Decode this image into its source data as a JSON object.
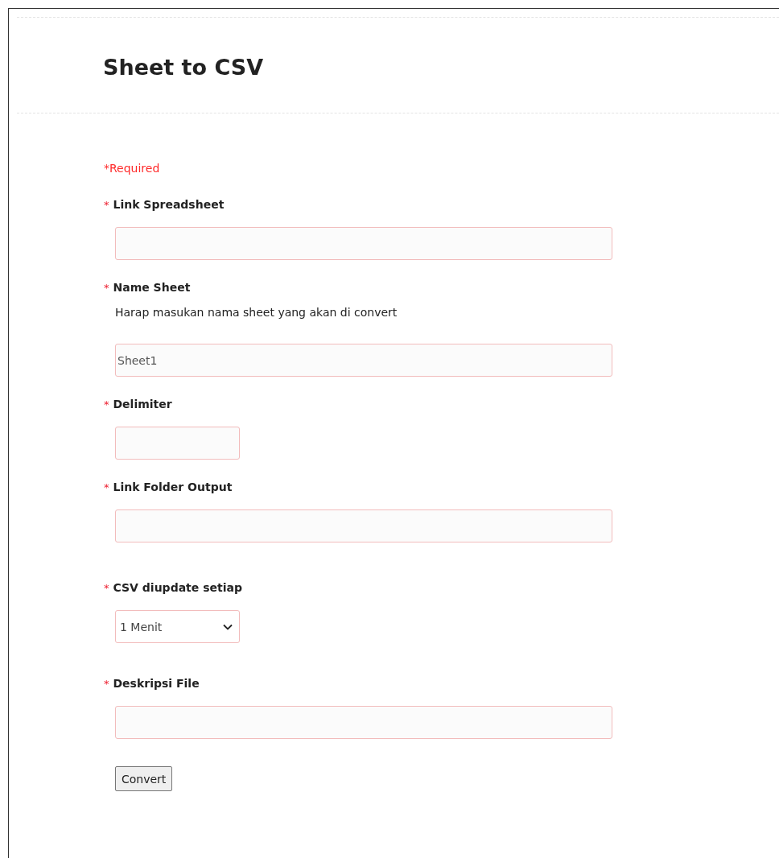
{
  "title": "Sheet to CSV",
  "required_note": "*Required",
  "fields": [
    {
      "kind": "text",
      "mark": "*",
      "label": "Link Spreadsheet"
    },
    {
      "kind": "text",
      "mark": "*",
      "label": "Name Sheet",
      "help": "Harap masukan nama sheet yang akan di convert",
      "value": "Sheet1"
    },
    {
      "kind": "short-text",
      "mark": "*",
      "label": "Delimiter"
    },
    {
      "kind": "text",
      "mark": "*",
      "label": "Link Folder Output"
    },
    {
      "kind": "select",
      "mark": "*",
      "label": "CSV diupdate setiap",
      "value": "1 Menit"
    },
    {
      "kind": "text",
      "mark": "*",
      "label": "Deskripsi File"
    }
  ],
  "submit": "Convert"
}
